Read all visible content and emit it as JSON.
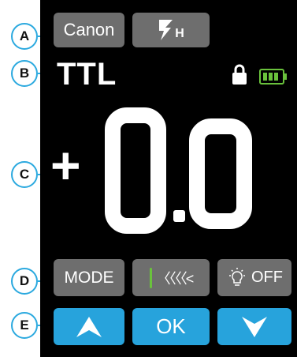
{
  "callouts": [
    "A",
    "B",
    "C",
    "D",
    "E"
  ],
  "top_row": {
    "brand_label": "Canon",
    "flash_mode_sub": "H",
    "flash_mode_icon": "flash-bolt-icon"
  },
  "status": {
    "mode": "TTL",
    "lock_icon": "lock-icon",
    "battery_icon": "battery-icon",
    "battery_color": "#6ac23c"
  },
  "value": {
    "sign": "+",
    "integer": "0",
    "decimal": "0"
  },
  "function_row": {
    "mode_label": "MODE",
    "arrows_label": "〈〈〈〈<",
    "light_label": "OFF",
    "light_icon": "bulb-icon"
  },
  "nav_row": {
    "up_icon": "up-arrow-icon",
    "ok_label": "OK",
    "down_icon": "down-arrow-icon"
  },
  "colors": {
    "accent": "#27a3dc",
    "button_gray": "#6e6e6e",
    "background": "#000000",
    "highlight_green": "#6ac23c"
  }
}
